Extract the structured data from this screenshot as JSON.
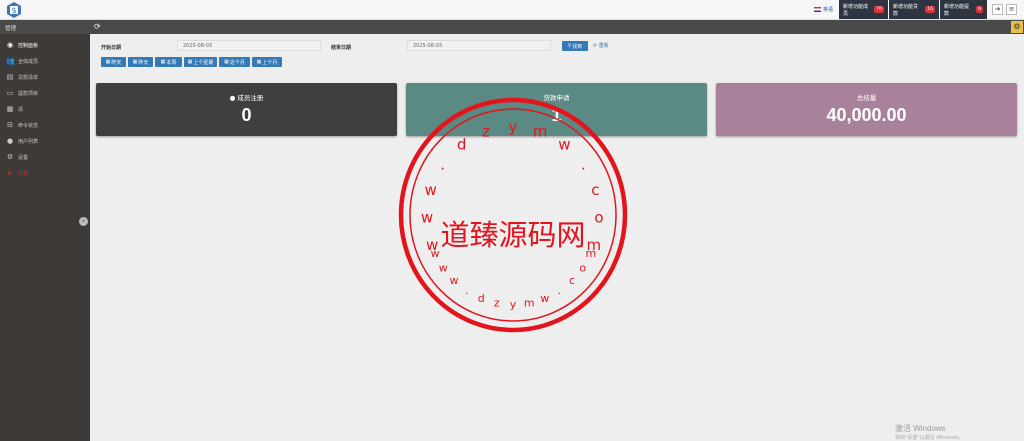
{
  "header": {
    "language": "英语",
    "notifications": [
      {
        "label": "新增功能成员",
        "count": "76"
      },
      {
        "label": "新增功能贷款",
        "count": "16"
      },
      {
        "label": "新增功能提款",
        "count": "6"
      }
    ],
    "management_label": "管理"
  },
  "sidebar": {
    "items": [
      {
        "label": "控制面板",
        "icon": "dashboard-icon"
      },
      {
        "label": "全体成员",
        "icon": "users-icon"
      },
      {
        "label": "贷款清单",
        "icon": "list-icon"
      },
      {
        "label": "提款项目",
        "icon": "withdraw-icon"
      },
      {
        "label": "清",
        "icon": "grid-icon"
      },
      {
        "label": "命令状态",
        "icon": "cart-icon"
      },
      {
        "label": "用户列表",
        "icon": "user-icon"
      },
      {
        "label": "设置",
        "icon": "gear-icon"
      },
      {
        "label": "注销",
        "icon": "logout-icon"
      }
    ]
  },
  "filter": {
    "start_label": "开始日期",
    "start_value": "2025-08-03",
    "end_label": "结束日期",
    "end_value": "2025-08-03",
    "search_label": "找到",
    "reset_label": "重新",
    "quick_ranges": [
      "昨天",
      "昨天",
      "本周",
      "上个星期",
      "这个月",
      "上个月"
    ]
  },
  "cards": [
    {
      "title": "成员注册",
      "value": "0",
      "color": "#3f3f3f"
    },
    {
      "title": "贷款申请",
      "value": "1",
      "color": "#5b8a85"
    },
    {
      "title": "总结量",
      "value": "40,000.00",
      "color": "#a8829b"
    }
  ],
  "watermark": {
    "site": "www.dzymw.com",
    "name": "道臻源码网",
    "color": "#e3141c"
  },
  "os_notice": {
    "title": "激活 Windows",
    "subtitle": "转到\"设置\"以激活 Windows。"
  }
}
